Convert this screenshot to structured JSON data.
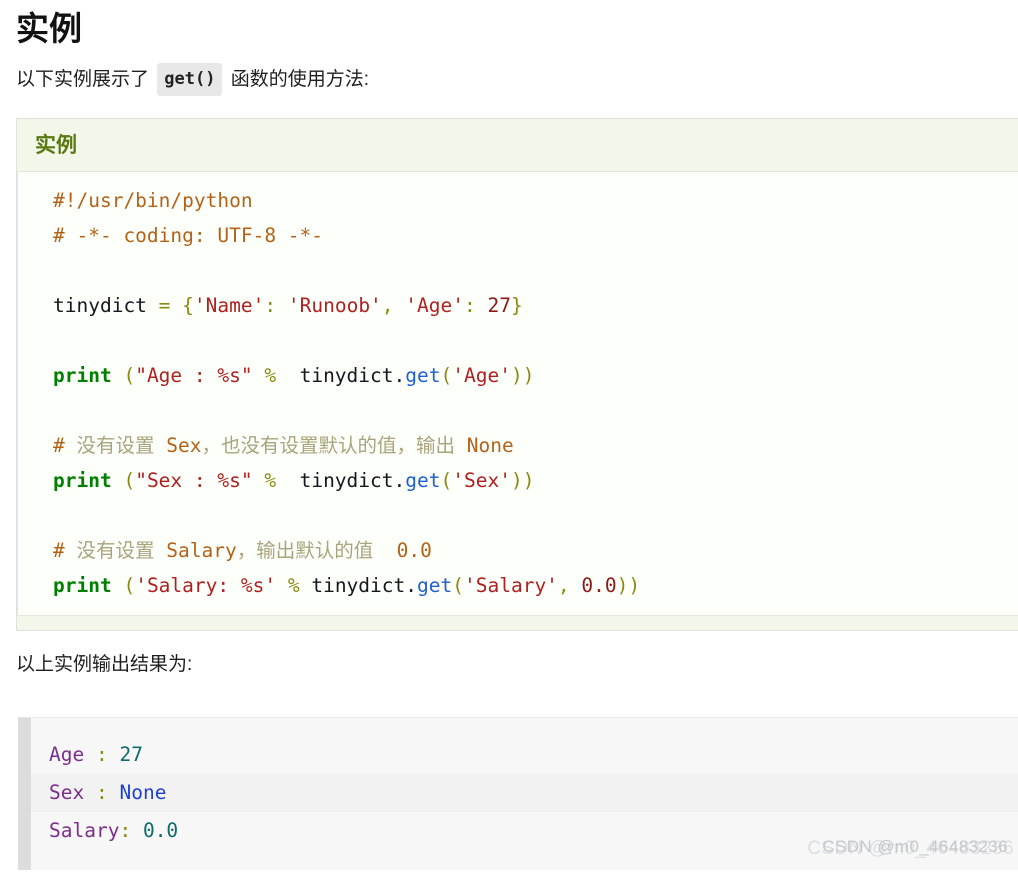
{
  "page": {
    "title": "实例",
    "intro_before": "以下实例展示了",
    "intro_code": "get()",
    "intro_after": "函数的使用方法:",
    "output_caption": "以上实例输出结果为:"
  },
  "example_panel": {
    "title": "实例",
    "language": "python",
    "code_lines": [
      {
        "tokens": [
          {
            "t": "#!/usr/bin/python",
            "c": "c"
          }
        ]
      },
      {
        "tokens": [
          {
            "t": "# -*- coding: UTF-8 -*-",
            "c": "c"
          }
        ]
      },
      {
        "tokens": [
          {
            "t": "",
            "c": "v"
          }
        ]
      },
      {
        "tokens": [
          {
            "t": "tinydict ",
            "c": "v"
          },
          {
            "t": "=",
            "c": "p"
          },
          {
            "t": " ",
            "c": "v"
          },
          {
            "t": "{",
            "c": "p"
          },
          {
            "t": "'Name'",
            "c": "s"
          },
          {
            "t": ":",
            "c": "p"
          },
          {
            "t": " ",
            "c": "v"
          },
          {
            "t": "'Runoob'",
            "c": "s"
          },
          {
            "t": ",",
            "c": "p"
          },
          {
            "t": " ",
            "c": "v"
          },
          {
            "t": "'Age'",
            "c": "s"
          },
          {
            "t": ":",
            "c": "p"
          },
          {
            "t": " ",
            "c": "v"
          },
          {
            "t": "27",
            "c": "n"
          },
          {
            "t": "}",
            "c": "p"
          }
        ]
      },
      {
        "tokens": [
          {
            "t": "",
            "c": "v"
          }
        ]
      },
      {
        "tokens": [
          {
            "t": "print",
            "c": "k"
          },
          {
            "t": " ",
            "c": "v"
          },
          {
            "t": "(",
            "c": "p"
          },
          {
            "t": "\"Age : %s\"",
            "c": "s"
          },
          {
            "t": " ",
            "c": "v"
          },
          {
            "t": "%",
            "c": "p"
          },
          {
            "t": "  tinydict",
            "c": "v"
          },
          {
            "t": ".",
            "c": "v"
          },
          {
            "t": "get",
            "c": "f"
          },
          {
            "t": "(",
            "c": "p"
          },
          {
            "t": "'Age'",
            "c": "s"
          },
          {
            "t": "))",
            "c": "p"
          }
        ]
      },
      {
        "tokens": [
          {
            "t": "",
            "c": "v"
          }
        ]
      },
      {
        "tokens": [
          {
            "t": "# ",
            "c": "c"
          },
          {
            "t": "没有设置",
            "c": "cz"
          },
          {
            "t": " Sex",
            "c": "c"
          },
          {
            "t": "，也没有设置默认的值，输出",
            "c": "cz"
          },
          {
            "t": " None",
            "c": "c"
          }
        ]
      },
      {
        "tokens": [
          {
            "t": "print",
            "c": "k"
          },
          {
            "t": " ",
            "c": "v"
          },
          {
            "t": "(",
            "c": "p"
          },
          {
            "t": "\"Sex : %s\"",
            "c": "s"
          },
          {
            "t": " ",
            "c": "v"
          },
          {
            "t": "%",
            "c": "p"
          },
          {
            "t": "  tinydict",
            "c": "v"
          },
          {
            "t": ".",
            "c": "v"
          },
          {
            "t": "get",
            "c": "f"
          },
          {
            "t": "(",
            "c": "p"
          },
          {
            "t": "'Sex'",
            "c": "s"
          },
          {
            "t": "))",
            "c": "p"
          }
        ]
      },
      {
        "tokens": [
          {
            "t": "",
            "c": "v"
          }
        ]
      },
      {
        "tokens": [
          {
            "t": "# ",
            "c": "c"
          },
          {
            "t": "没有设置",
            "c": "cz"
          },
          {
            "t": " Salary",
            "c": "c"
          },
          {
            "t": "，输出默认的值",
            "c": "cz"
          },
          {
            "t": "  0.0",
            "c": "c"
          }
        ]
      },
      {
        "tokens": [
          {
            "t": "print",
            "c": "k"
          },
          {
            "t": " ",
            "c": "v"
          },
          {
            "t": "(",
            "c": "p"
          },
          {
            "t": "'Salary: %s'",
            "c": "s"
          },
          {
            "t": " ",
            "c": "v"
          },
          {
            "t": "%",
            "c": "p"
          },
          {
            "t": " tinydict",
            "c": "v"
          },
          {
            "t": ".",
            "c": "v"
          },
          {
            "t": "get",
            "c": "f"
          },
          {
            "t": "(",
            "c": "p"
          },
          {
            "t": "'Salary'",
            "c": "s"
          },
          {
            "t": ",",
            "c": "p"
          },
          {
            "t": " ",
            "c": "v"
          },
          {
            "t": "0.0",
            "c": "n"
          },
          {
            "t": "))",
            "c": "p"
          }
        ]
      }
    ]
  },
  "output_panel": {
    "rows": [
      {
        "tokens": [
          {
            "t": "Age",
            "c": "ok"
          },
          {
            "t": " ",
            "c": "ok"
          },
          {
            "t": ":",
            "c": "oc"
          },
          {
            "t": " ",
            "c": "ov"
          },
          {
            "t": "27",
            "c": "ov"
          }
        ]
      },
      {
        "tokens": [
          {
            "t": "Sex",
            "c": "ok"
          },
          {
            "t": " ",
            "c": "ok"
          },
          {
            "t": ":",
            "c": "oc"
          },
          {
            "t": " ",
            "c": "on"
          },
          {
            "t": "None",
            "c": "on"
          }
        ]
      },
      {
        "tokens": [
          {
            "t": "Salary",
            "c": "ok"
          },
          {
            "t": ":",
            "c": "oc"
          },
          {
            "t": " ",
            "c": "ov"
          },
          {
            "t": "0.0",
            "c": "ov"
          }
        ]
      }
    ],
    "plain_text": "Age : 27\nSex : None\nSalary: 0.0"
  },
  "watermark": {
    "text": "CSDN @m0_46483236",
    "ghost_text": "CSDN @m0_46483236"
  },
  "colors": {
    "panel_background": "#f3f7e9",
    "panel_title": "#5a7812",
    "code_surface": "#fdfffa",
    "comment": "#b36218",
    "comment_cjk": "#a9a47c",
    "keyword": "#008000",
    "string": "#b02020",
    "number": "#8b1a1a",
    "punctuation": "#8a8a12",
    "function": "#1f5fd0",
    "output_key": "#7b2d8b",
    "output_value": "#0d6b6b",
    "output_none": "#1f3fd0",
    "output_background": "#f7f7f7",
    "output_gutter": "#dcdcdc",
    "inline_code_background": "#e8e8e8",
    "watermark": "#c4c8cc"
  }
}
